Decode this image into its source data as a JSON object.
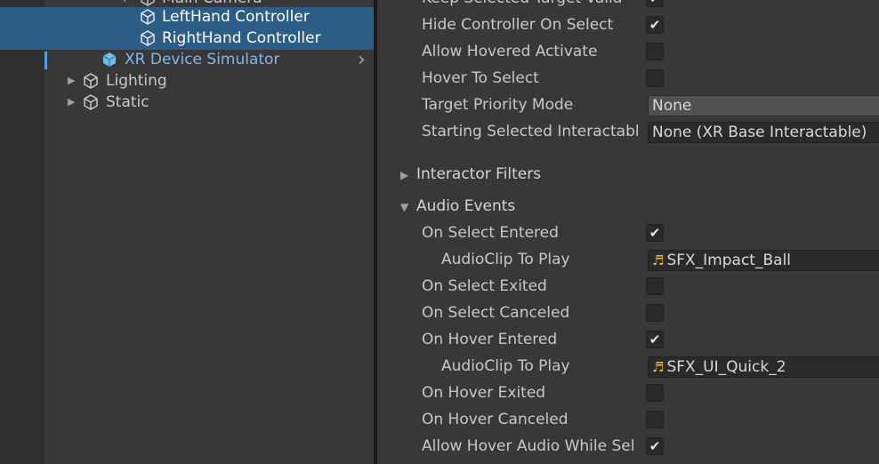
{
  "hierarchy": {
    "partial_top_item": "Main Camera",
    "items": [
      {
        "label": "LeftHand Controller"
      },
      {
        "label": "RightHand Controller"
      },
      {
        "label": "XR Device Simulator"
      },
      {
        "label": "Lighting"
      },
      {
        "label": "Static"
      }
    ]
  },
  "inspector": {
    "rows": [
      {
        "label": "Keep Selected Target Valid",
        "checked": "✔"
      },
      {
        "label": "Hide Controller On Select",
        "checked": "✔"
      },
      {
        "label": "Allow Hovered Activate",
        "checked": ""
      },
      {
        "label": "Hover To Select",
        "checked": ""
      }
    ],
    "target_priority": {
      "label": "Target Priority Mode",
      "value": "None"
    },
    "starting_selected": {
      "label": "Starting Selected Interactabl",
      "value": "None (XR Base Interactable)"
    },
    "sections": {
      "interactor_filters": "Interactor Filters",
      "audio_events": "Audio Events"
    },
    "audio_rows": [
      {
        "label": "On Select Entered",
        "checked": "✔"
      },
      {
        "label": "AudioClip To Play",
        "value": "SFX_Impact_Ball"
      },
      {
        "label": "On Select Exited",
        "checked": ""
      },
      {
        "label": "On Select Canceled",
        "checked": ""
      },
      {
        "label": "On Hover Entered",
        "checked": "✔"
      },
      {
        "label": "AudioClip To Play",
        "value": "SFX_UI_Quick_2"
      },
      {
        "label": "On Hover Exited",
        "checked": ""
      },
      {
        "label": "On Hover Canceled",
        "checked": ""
      },
      {
        "label": "Allow Hover Audio While Sel",
        "checked": "✔"
      }
    ],
    "audio_clip_icon": "music-note-icon"
  }
}
